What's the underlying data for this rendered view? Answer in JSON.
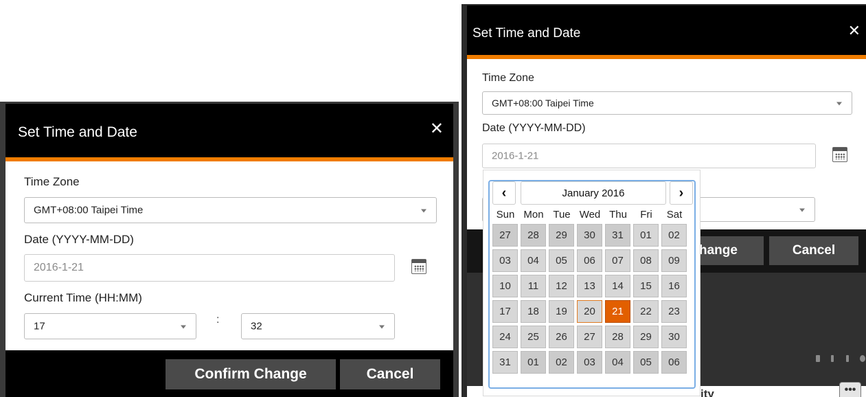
{
  "left_dialog": {
    "title": "Set Time and Date",
    "close_glyph": "✕",
    "timezone_label": "Time Zone",
    "timezone_value": "GMT+08:00 Taipei Time",
    "date_label": "Date (YYYY-MM-DD)",
    "date_value": "2016-1-21",
    "calendar_icon": "calendar-icon",
    "time_label": "Current Time (HH:MM)",
    "hour_value": "17",
    "minute_value": "32",
    "colon": ":",
    "confirm_label": "Confirm Change",
    "cancel_label": "Cancel"
  },
  "right_dialog": {
    "title": "Set Time and Date",
    "close_glyph": "✕",
    "timezone_label": "Time Zone",
    "timezone_value": "GMT+08:00 Taipei Time",
    "date_label": "Date (YYYY-MM-DD)",
    "date_value": "2016-1-21",
    "calendar_icon": "calendar-icon",
    "confirm_label_partial": "hange",
    "cancel_label": "Cancel",
    "background_partial_text": "ity",
    "more_glyph": "•••"
  },
  "datepicker": {
    "prev_glyph": "‹",
    "next_glyph": "›",
    "month_label": "January 2016",
    "weekdays": [
      "Sun",
      "Mon",
      "Tue",
      "Wed",
      "Thu",
      "Fri",
      "Sat"
    ],
    "weeks": [
      [
        "27",
        "28",
        "29",
        "30",
        "31",
        "01",
        "02"
      ],
      [
        "03",
        "04",
        "05",
        "06",
        "07",
        "08",
        "09"
      ],
      [
        "10",
        "11",
        "12",
        "13",
        "14",
        "15",
        "16"
      ],
      [
        "17",
        "18",
        "19",
        "20",
        "21",
        "22",
        "23"
      ],
      [
        "24",
        "25",
        "26",
        "27",
        "28",
        "29",
        "30"
      ],
      [
        "31",
        "01",
        "02",
        "03",
        "04",
        "05",
        "06"
      ]
    ],
    "selected_day": "21",
    "today_day": "20"
  },
  "colors": {
    "accent": "#f07c00",
    "selected_day_bg": "#e25f00",
    "header_bg": "#000000",
    "button_bg": "#4a4a4a",
    "picker_border": "#7aaee5"
  }
}
